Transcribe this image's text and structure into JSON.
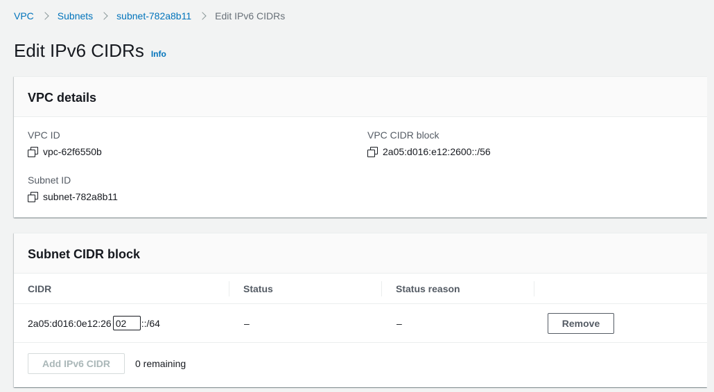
{
  "breadcrumb": {
    "items": [
      "VPC",
      "Subnets",
      "subnet-782a8b11"
    ],
    "current": "Edit IPv6 CIDRs"
  },
  "page": {
    "title": "Edit IPv6 CIDRs",
    "info_label": "Info"
  },
  "vpc_details": {
    "heading": "VPC details",
    "vpc_id_label": "VPC ID",
    "vpc_id_value": "vpc-62f6550b",
    "vpc_cidr_label": "VPC CIDR block",
    "vpc_cidr_value": "2a05:d016:e12:2600::/56",
    "subnet_id_label": "Subnet ID",
    "subnet_id_value": "subnet-782a8b11"
  },
  "subnet_cidr": {
    "heading": "Subnet CIDR block",
    "columns": [
      "CIDR",
      "Status",
      "Status reason",
      ""
    ],
    "rows": [
      {
        "cidr_prefix": "2a05:d016:0e12:26",
        "cidr_input_value": "02",
        "cidr_suffix": "::/64",
        "status": "–",
        "status_reason": "–",
        "action_label": "Remove"
      }
    ],
    "add_button_label": "Add IPv6 CIDR",
    "remaining_text": "0 remaining"
  },
  "icons": {
    "copy": "copy-icon",
    "separator": "chevron-right-icon"
  },
  "colors": {
    "link": "#0073bb",
    "background": "#f2f3f3",
    "text": "#16191f",
    "muted": "#545b64"
  }
}
